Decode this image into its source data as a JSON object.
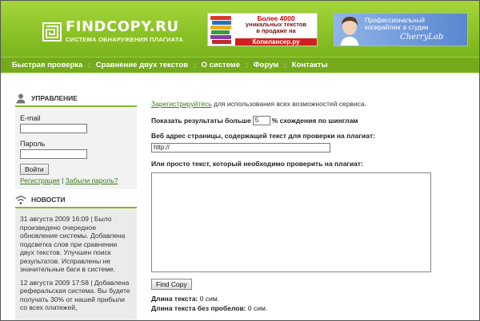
{
  "header": {
    "logo_title": "FINDCOPY.RU",
    "logo_subtitle": "СИСТЕМА ОБНАРУЖЕНИЯ ПЛАГИАТА",
    "banner1": {
      "line1": "Более 4000",
      "line2": "уникальных текстов",
      "line3": "в продаже на",
      "url": "Копилансер.ру"
    },
    "banner2": {
      "line1": "Профессиональный",
      "line2": "копирайтинг в студии",
      "brand": "CherryLab"
    }
  },
  "nav": {
    "items": [
      "Быстрая проверка",
      "Сравнение двух текстов",
      "О системе",
      "Форум",
      "Контакты"
    ],
    "separator": "::"
  },
  "sidebar": {
    "control_title": "УПРАВЛЕНИЕ",
    "email_label": "E-mail",
    "password_label": "Пароль",
    "login_button": "Войти",
    "register_link": "Регистрация",
    "link_separator": "|",
    "forgot_link": "Забыли пароль?",
    "news_title": "НОВОСТИ",
    "news": [
      "31 августа 2009 16:09 | Было произведено очередное обновление системы. Добавлена подсветка слов при сравнении двух текстов. Улучшен поиск результатов. Исправлены не значительные баги в системе.",
      "12 августа 2009 17:58 | Добавлена реферальская система. Вы будете получать 30% от нашей прибыли со всех платежей,"
    ]
  },
  "main": {
    "register_link": "Зарегистрируйтесь",
    "register_text": " для использования всех возможностей сервиса.",
    "threshold_prefix": "Показать результаты больше",
    "threshold_value": "5",
    "threshold_suffix": "% схождения по шинглам",
    "url_label": "Веб адрес страницы, содержащей текст для проверки на плагиат:",
    "url_value": "http://",
    "text_label": "Или просто текст, который необходимо проверить на плагиат:",
    "find_button": "Find Copy",
    "length_label": "Длина текста:",
    "length_value": "0 сим.",
    "length_nospace_label": "Длина текста без пробелов:",
    "length_nospace_value": "0 сим."
  },
  "colors": {
    "header_green": "#8cc327",
    "nav_green": "#75aa1c",
    "link_green": "#3a7a1a"
  }
}
